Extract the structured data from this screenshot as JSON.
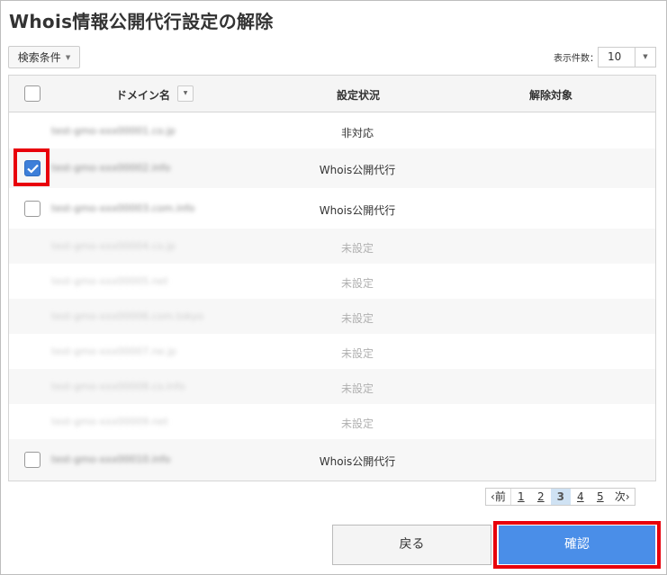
{
  "page": {
    "title": "Whois情報公開代行設定の解除"
  },
  "toolbar": {
    "search_conditions": "検索条件",
    "count_label": "表示件数：",
    "count_value": "10"
  },
  "table": {
    "headers": {
      "domain": "ドメイン名",
      "status": "設定状況",
      "target": "解除対象"
    },
    "rows": [
      {
        "domain": "test-gmo-xxx00001.co.jp",
        "status": "非対応",
        "checkbox": false,
        "checked": false,
        "disabled": false
      },
      {
        "domain": "test-gmo-xxx00002.info",
        "status": "Whois公開代行",
        "checkbox": true,
        "checked": true,
        "disabled": false
      },
      {
        "domain": "test-gmo-xxx00003.com.info",
        "status": "Whois公開代行",
        "checkbox": true,
        "checked": false,
        "disabled": false
      },
      {
        "domain": "test-gmo-xxx00004.co.jp",
        "status": "未設定",
        "checkbox": false,
        "checked": false,
        "disabled": true
      },
      {
        "domain": "test-gmo-xxx00005.net",
        "status": "未設定",
        "checkbox": false,
        "checked": false,
        "disabled": true
      },
      {
        "domain": "test-gmo-xxx00006.com.tokyo",
        "status": "未設定",
        "checkbox": false,
        "checked": false,
        "disabled": true
      },
      {
        "domain": "test-gmo-xxx00007.ne.jp",
        "status": "未設定",
        "checkbox": false,
        "checked": false,
        "disabled": true
      },
      {
        "domain": "test-gmo-xxx00008.co.info",
        "status": "未設定",
        "checkbox": false,
        "checked": false,
        "disabled": true
      },
      {
        "domain": "test-gmo-xxx00009.net",
        "status": "未設定",
        "checkbox": false,
        "checked": false,
        "disabled": true
      },
      {
        "domain": "test-gmo-xxx00010.info",
        "status": "Whois公開代行",
        "checkbox": true,
        "checked": false,
        "disabled": false
      }
    ]
  },
  "pagination": {
    "prev": "前",
    "next": "次",
    "pages": [
      "1",
      "2",
      "3",
      "4",
      "5"
    ],
    "current": "3"
  },
  "actions": {
    "back": "戻る",
    "confirm": "確認"
  },
  "colors": {
    "accent": "#4a8ee8",
    "highlight": "#e8000b",
    "checked": "#3d7fd9"
  }
}
